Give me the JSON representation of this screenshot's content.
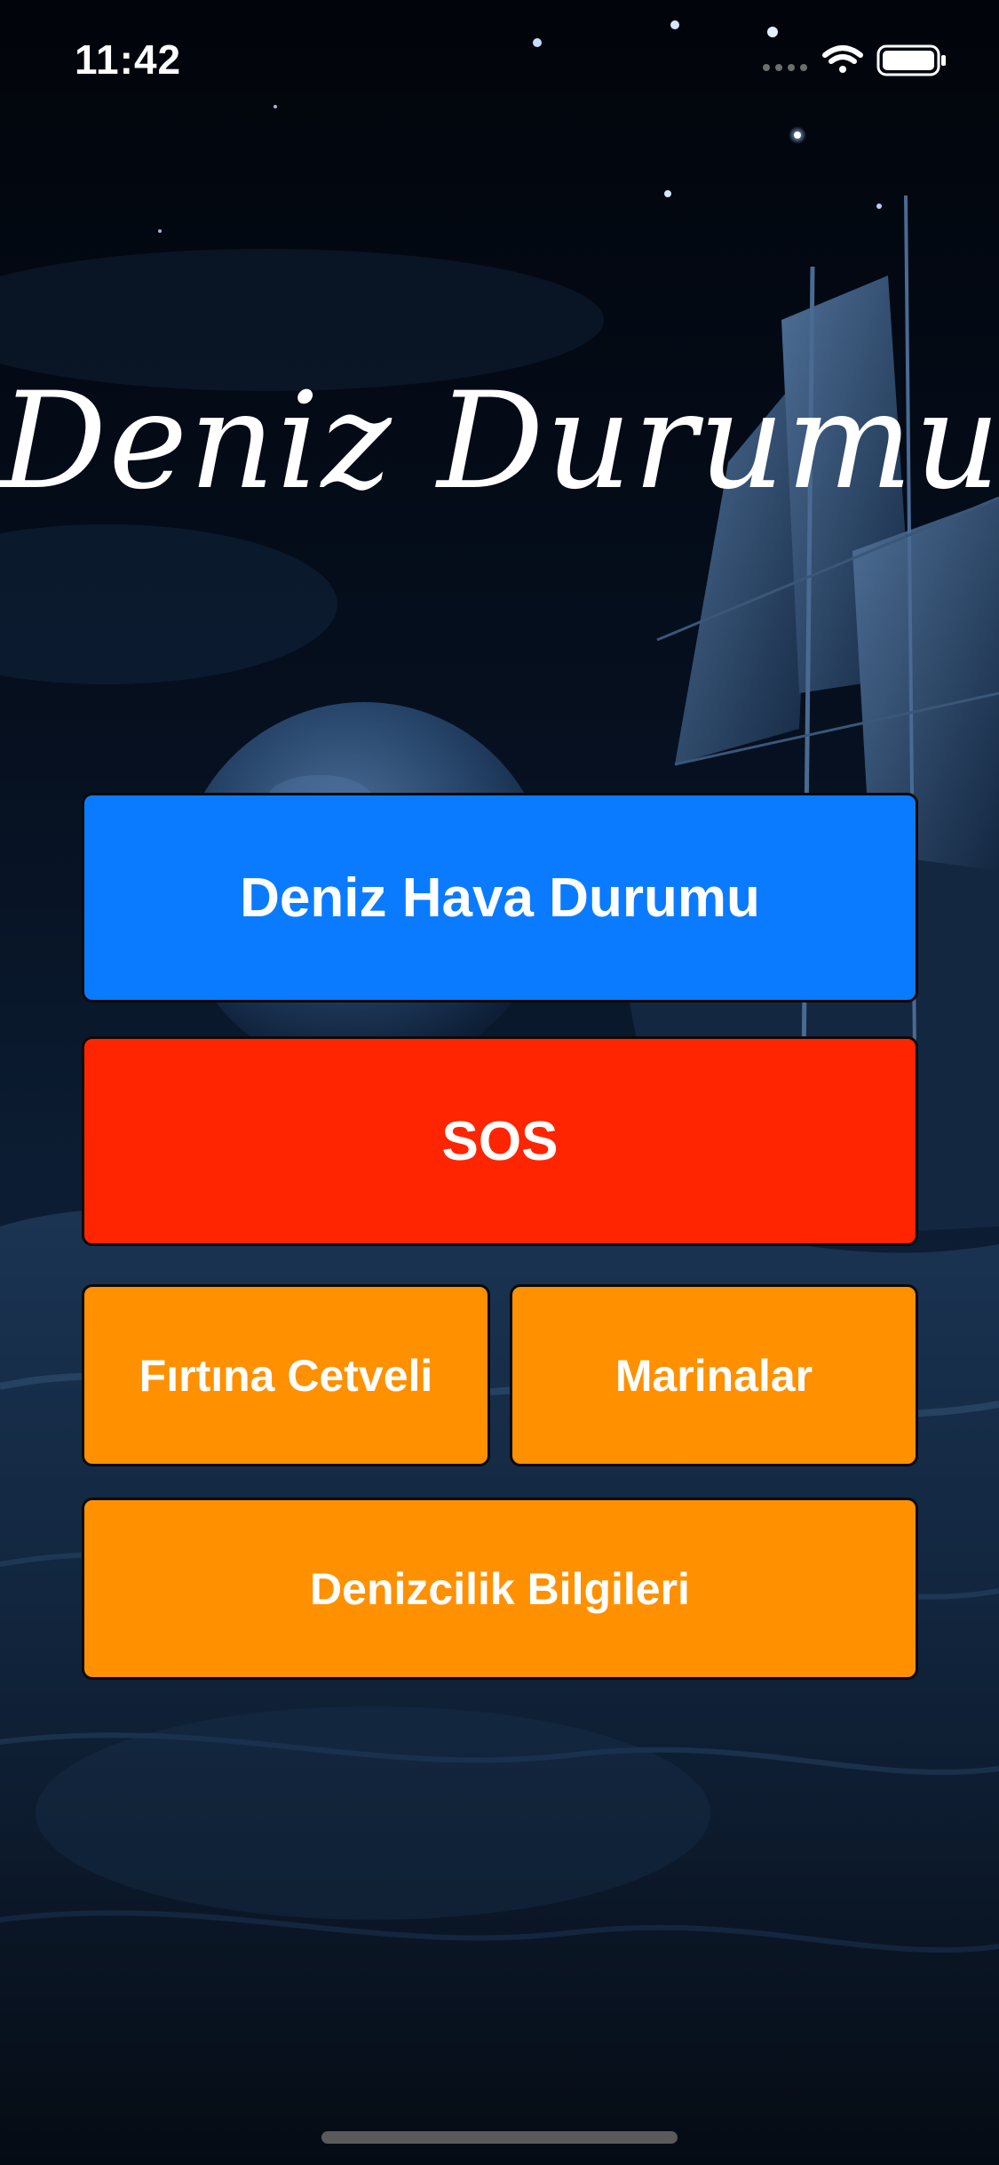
{
  "status_bar": {
    "time": "11:42",
    "icons": [
      "signal-dots-icon",
      "wifi-icon",
      "battery-icon"
    ]
  },
  "app": {
    "title": "Deniz Durumu",
    "background": "night-sea-ship-image"
  },
  "buttons": {
    "weather": "Deniz Hava Durumu",
    "sos": "SOS",
    "storm_scale": "Fırtına Cetveli",
    "marinas": "Marinalar",
    "maritime_info": "Denizcilik Bilgileri"
  },
  "colors": {
    "weather": "#0a7bff",
    "sos": "#ff2500",
    "secondary": "#ff9000"
  }
}
